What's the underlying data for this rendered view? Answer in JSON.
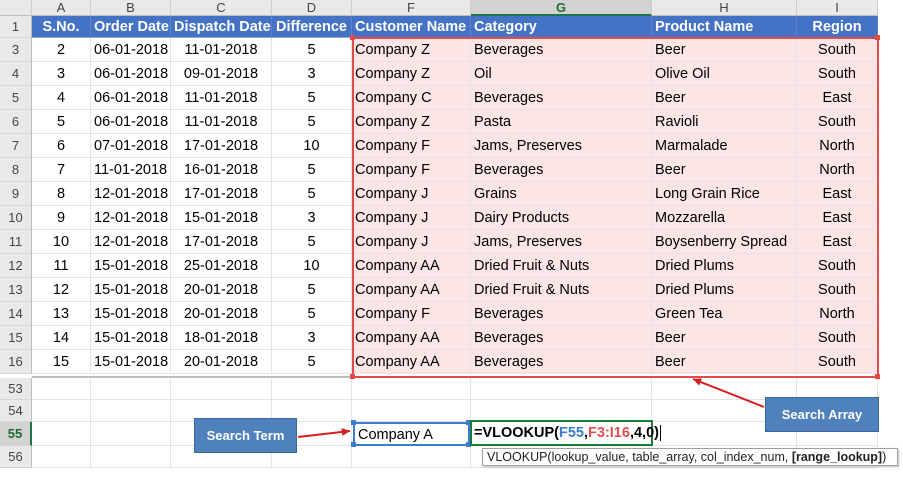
{
  "columns": [
    "A",
    "B",
    "C",
    "D",
    "F",
    "G",
    "H",
    "I"
  ],
  "selected_column": "G",
  "header_row": {
    "row_number": "1",
    "cells": [
      "S.No.",
      "Order Date",
      "Dispatch Date",
      "Difference",
      "Customer Name",
      "Category",
      "Product Name",
      "Region"
    ]
  },
  "data_rows": [
    {
      "row_number": "3",
      "cells": [
        "2",
        "06-01-2018",
        "11-01-2018",
        "5",
        "Company Z",
        "Beverages",
        "Beer",
        "South"
      ]
    },
    {
      "row_number": "4",
      "cells": [
        "3",
        "06-01-2018",
        "09-01-2018",
        "3",
        "Company Z",
        "Oil",
        "Olive Oil",
        "South"
      ]
    },
    {
      "row_number": "5",
      "cells": [
        "4",
        "06-01-2018",
        "11-01-2018",
        "5",
        "Company C",
        "Beverages",
        "Beer",
        "East"
      ]
    },
    {
      "row_number": "6",
      "cells": [
        "5",
        "06-01-2018",
        "11-01-2018",
        "5",
        "Company Z",
        "Pasta",
        "Ravioli",
        "South"
      ]
    },
    {
      "row_number": "7",
      "cells": [
        "6",
        "07-01-2018",
        "17-01-2018",
        "10",
        "Company F",
        "Jams, Preserves",
        "Marmalade",
        "North"
      ]
    },
    {
      "row_number": "8",
      "cells": [
        "7",
        "11-01-2018",
        "16-01-2018",
        "5",
        "Company F",
        "Beverages",
        "Beer",
        "North"
      ]
    },
    {
      "row_number": "9",
      "cells": [
        "8",
        "12-01-2018",
        "17-01-2018",
        "5",
        "Company J",
        "Grains",
        "Long Grain Rice",
        "East"
      ]
    },
    {
      "row_number": "10",
      "cells": [
        "9",
        "12-01-2018",
        "15-01-2018",
        "3",
        "Company J",
        "Dairy Products",
        "Mozzarella",
        "East"
      ]
    },
    {
      "row_number": "11",
      "cells": [
        "10",
        "12-01-2018",
        "17-01-2018",
        "5",
        "Company J",
        "Jams, Preserves",
        "Boysenberry Spread",
        "East"
      ]
    },
    {
      "row_number": "12",
      "cells": [
        "11",
        "15-01-2018",
        "25-01-2018",
        "10",
        "Company AA",
        "Dried Fruit & Nuts",
        "Dried Plums",
        "South"
      ]
    },
    {
      "row_number": "13",
      "cells": [
        "12",
        "15-01-2018",
        "20-01-2018",
        "5",
        "Company AA",
        "Dried Fruit & Nuts",
        "Dried Plums",
        "South"
      ]
    },
    {
      "row_number": "14",
      "cells": [
        "13",
        "15-01-2018",
        "20-01-2018",
        "5",
        "Company F",
        "Beverages",
        "Green Tea",
        "North"
      ]
    },
    {
      "row_number": "15",
      "cells": [
        "14",
        "15-01-2018",
        "18-01-2018",
        "3",
        "Company AA",
        "Beverages",
        "Beer",
        "South"
      ]
    },
    {
      "row_number": "16",
      "cells": [
        "15",
        "15-01-2018",
        "20-01-2018",
        "5",
        "Company AA",
        "Beverages",
        "Beer",
        "South"
      ]
    }
  ],
  "lower_rows": [
    {
      "row_number": "53",
      "selected": false
    },
    {
      "row_number": "54",
      "selected": false
    },
    {
      "row_number": "55",
      "selected": true
    },
    {
      "row_number": "56",
      "selected": false
    }
  ],
  "lookup_value_cell": {
    "ref": "F55",
    "value": "Company A"
  },
  "formula": {
    "prefix": "=VLOOKUP(",
    "ref1": "F55",
    "sep1": ",",
    "ref2": "F3:I16",
    "suffix": ",4,0)"
  },
  "tooltip": {
    "text": "VLOOKUP(lookup_value, table_array, col_index_num, ",
    "bold": "[range_lookup]",
    "close": ")"
  },
  "callouts": {
    "search_term": "Search Term",
    "search_array": "Search Array"
  },
  "colors": {
    "header_blue": "#4472c4",
    "highlight_pink": "#fbe5e5",
    "range_border_red": "#e34a4a",
    "callout_blue": "#4f81bd",
    "edit_green": "#1a7a3a"
  }
}
